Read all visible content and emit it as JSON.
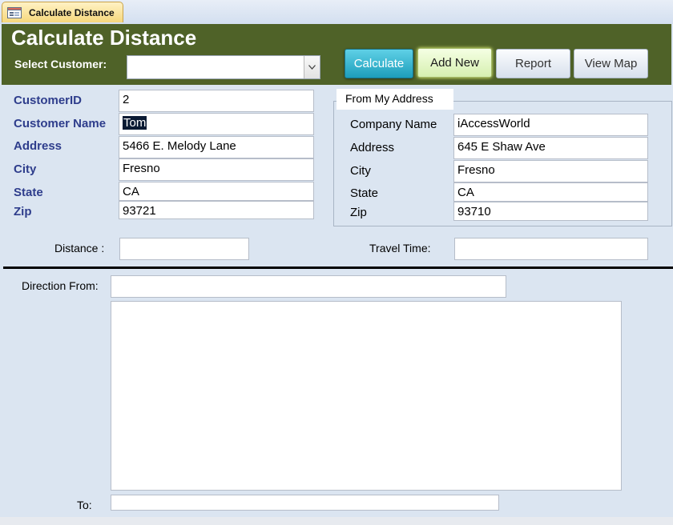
{
  "tab": {
    "label": "Calculate Distance"
  },
  "header": {
    "title": "Calculate Distance",
    "select_customer_label": "Select Customer:",
    "select_customer_value": ""
  },
  "buttons": {
    "calculate": "Calculate",
    "add_new": "Add New",
    "report": "Report",
    "view_map": "View Map"
  },
  "customer": {
    "customer_id": {
      "label": "CustomerID",
      "value": "2"
    },
    "customer_name": {
      "label": "Customer Name",
      "value": "Tom"
    },
    "address": {
      "label": "Address",
      "value": "5466 E. Melody Lane"
    },
    "city": {
      "label": "City",
      "value": "Fresno"
    },
    "state": {
      "label": "State",
      "value": "CA"
    },
    "zip": {
      "label": "Zip",
      "value": "93721"
    }
  },
  "from_address": {
    "title": "From My Address",
    "company_name": {
      "label": "Company Name",
      "value": "iAccessWorld"
    },
    "address": {
      "label": "Address",
      "value": "645 E Shaw Ave"
    },
    "city": {
      "label": "City",
      "value": "Fresno"
    },
    "state": {
      "label": "State",
      "value": "CA"
    },
    "zip": {
      "label": "Zip",
      "value": "93710"
    }
  },
  "distance": {
    "label": "Distance :",
    "value": ""
  },
  "travel_time": {
    "label": "Travel Time:",
    "value": ""
  },
  "directions": {
    "from_label": "Direction From:",
    "from_value": "",
    "body": "",
    "to_label": "To:",
    "to_value": ""
  },
  "colors": {
    "header_bg": "#4f6228",
    "form_bg": "#dbe5f1",
    "label_blue": "#2e3d8c",
    "calculate_button": "#1d9ebb"
  }
}
